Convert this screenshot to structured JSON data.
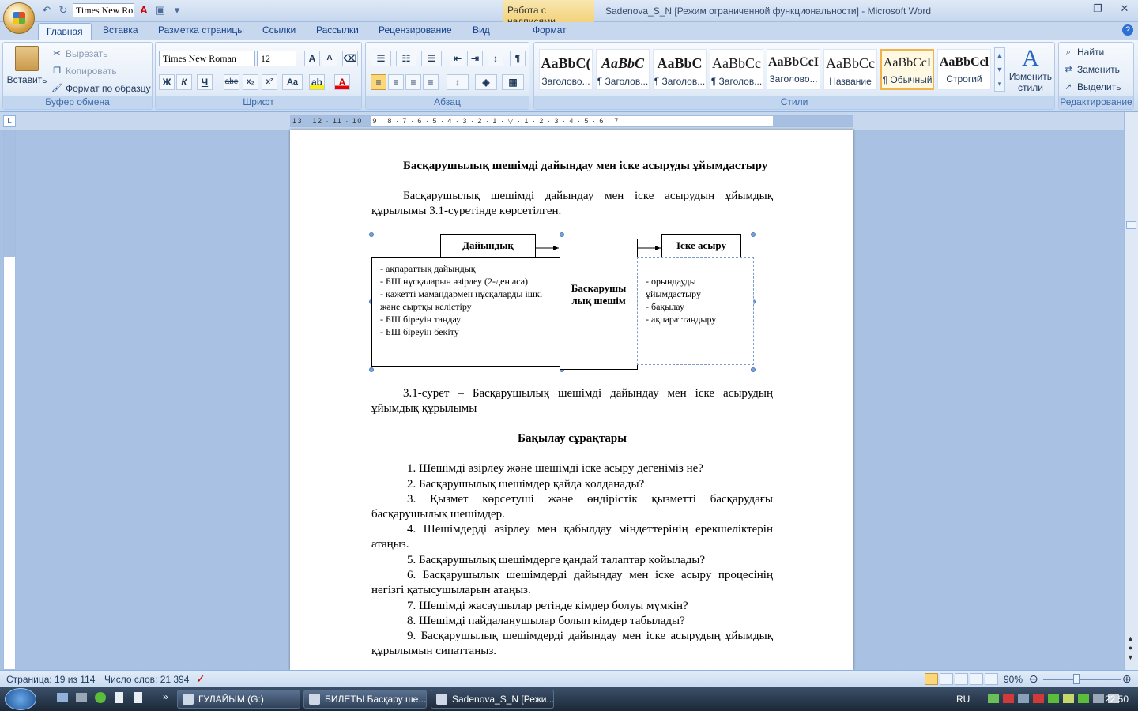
{
  "qat": {
    "font_name": "Times New Roman"
  },
  "titlebar": {
    "context_tab": "Работа с надписями",
    "title": "Sadenova_S_N [Режим ограниченной функциональности] - Microsoft Word"
  },
  "tabs": [
    "Главная",
    "Вставка",
    "Разметка страницы",
    "Ссылки",
    "Рассылки",
    "Рецензирование",
    "Вид",
    "Формат"
  ],
  "ribbon": {
    "clipboard": {
      "paste": "Вставить",
      "cut": "Вырезать",
      "copy": "Копировать",
      "format_painter": "Формат по образцу",
      "label": "Буфер обмена"
    },
    "font": {
      "family": "Times New Roman",
      "size": "12",
      "bold": "Ж",
      "italic": "К",
      "underline": "Ч",
      "strike": "abe",
      "sub": "x₂",
      "sup": "x²",
      "case": "Aa",
      "label": "Шрифт"
    },
    "paragraph": {
      "label": "Абзац"
    },
    "styles": {
      "label": "Стили",
      "change": "Изменить стили",
      "items": [
        {
          "sample": "AaBbC(",
          "name": "Заголово..."
        },
        {
          "sample": "AaBbC",
          "name": "¶ Заголов..."
        },
        {
          "sample": "AaBbC",
          "name": "¶ Заголов..."
        },
        {
          "sample": "AaBbCc",
          "name": "¶ Заголов..."
        },
        {
          "sample": "AaBbCcI",
          "name": "Заголово..."
        },
        {
          "sample": "AaBbCc",
          "name": "Название"
        },
        {
          "sample": "AaBbCcI",
          "name": "¶ Обычный"
        },
        {
          "sample": "AaBbCcl",
          "name": "Строгий"
        }
      ]
    },
    "editing": {
      "find": "Найти",
      "replace": "Заменить",
      "select": "Выделить",
      "label": "Редактирование"
    }
  },
  "ruler": {
    "h_ticks": "13 · 12 · 11 · 10 · 9 · 8 · 7 · 6 · 5 · 4 · 3 · 2 · 1 · ▽ · 1 · 2 · 3 · 4 · 5 · 6 · 7"
  },
  "document": {
    "heading": "Басқарушылық шешімді дайындау мен іске асыруды ұйымдастыру",
    "intro": "Басқарушылық шешімді дайындау мен іске асырудың ұйымдық құрылымы 3.1-суретінде көрсетілген.",
    "diagram": {
      "prep_title": "Дайындық",
      "prep_items": [
        "- ақпараттық дайындық",
        "- БШ нұсқаларын әзірлеу (2-ден аса)",
        "- қажетті мамандармен нұсқаларды ішкі және сыртқы келістіру",
        "- БШ біреуін таңдау",
        "- БШ біреуін бекіту"
      ],
      "center": "Басқарушы лық шешім",
      "impl_title": "Іске асыру",
      "impl_items": [
        "- орындауды ұйымдастыру",
        "- бақылау",
        "- ақпараттандыру"
      ]
    },
    "caption": "3.1-сурет – Басқарушылық шешімді дайындау мен іске асырудың ұйымдық құрылымы",
    "questions_title": "Бақылау сұрақтары",
    "questions": [
      "1. Шешімді әзірлеу және шешімді іске асыру дегеніміз не?",
      "2. Басқарушылық шешімдер қайда қолданады?",
      "3. Қызмет көрсетуші және өндірістік қызметті басқарудағы басқарушылық шешімдер.",
      "4. Шешімдерді әзірлеу мен қабылдау міндеттерінің ерекшеліктерін атаңыз.",
      "5. Басқарушылық шешімдерге қандай талаптар қойылады?",
      "6. Басқарушылық шешімдерді дайындау мен іске асыру процесінің негізгі қатысушыларын атаңыз.",
      "7. Шешімді жасаушылар ретінде кімдер болуы мүмкін?",
      "8. Шешімді пайдаланушылар болып кімдер табылады?",
      "9. Басқарушылық шешімдерді дайындау мен іске асырудың ұйымдық құрылымын сипаттаңыз."
    ]
  },
  "status": {
    "page": "Страница: 19 из 114",
    "words": "Число слов: 21 394",
    "zoom": "90%"
  },
  "taskbar": {
    "items": [
      "ГУЛАЙЫМ (G:)",
      "БИЛЕТЫ Басқару ше...",
      "Sadenova_S_N [Режи..."
    ],
    "lang": "RU",
    "time": "22:50"
  }
}
